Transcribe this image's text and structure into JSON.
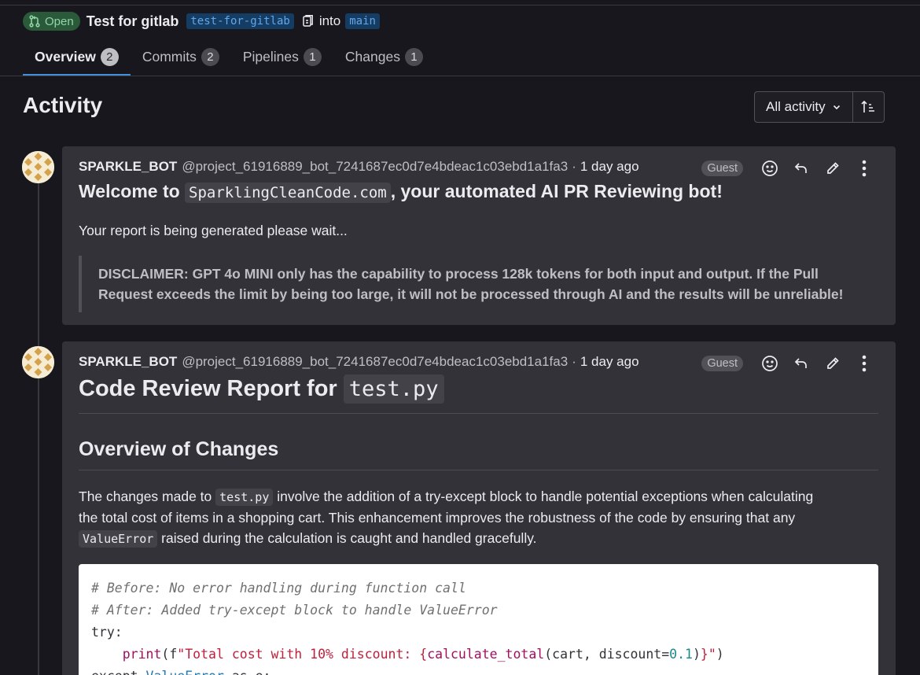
{
  "header": {
    "status_label": "Open",
    "title": "Test for gitlab",
    "source_branch": "test-for-gitlab",
    "into_label": "into",
    "target_branch": "main"
  },
  "tabs": [
    {
      "label": "Overview",
      "count": "2",
      "active": true
    },
    {
      "label": "Commits",
      "count": "2"
    },
    {
      "label": "Pipelines",
      "count": "1"
    },
    {
      "label": "Changes",
      "count": "1"
    }
  ],
  "activity": {
    "title": "Activity",
    "filter_label": "All activity"
  },
  "notes": [
    {
      "author": "SPARKLE_BOT",
      "username": "@project_61916889_bot_7241687ec0d7e4bdeac1c03ebd1a1fa3",
      "time": "1 day ago",
      "role": "Guest",
      "heading_pre": "Welcome to ",
      "heading_code": "SparklingCleanCode.com",
      "heading_post": ", your automated AI PR Reviewing bot!",
      "body": "Your report is being generated please wait...",
      "quote_line1": "DISCLAIMER: GPT 4o MINI only has the capability to process 128k tokens for both input and output. If the Pull",
      "quote_line2": "Request exceeds the limit by being too large, it will not be processed through AI and the results will be unreliable!"
    },
    {
      "author": "SPARKLE_BOT",
      "username": "@project_61916889_bot_7241687ec0d7e4bdeac1c03ebd1a1fa3",
      "time": "1 day ago",
      "role": "Guest",
      "h1_pre": "Code Review Report for ",
      "h1_code": "test.py",
      "h2": "Overview of Changes",
      "para_1": "The changes made to ",
      "para_code_1": "test.py",
      "para_2": " involve the addition of a try-except block to handle potential exceptions when calculating",
      "para_3": "the total cost of items in a shopping cart. This enhancement improves the robustness of the code by ensuring that any",
      "para_code_2": "ValueError",
      "para_4": " raised during the calculation is caught and handled gracefully.",
      "code": {
        "line1": "# Before: No error handling during function call",
        "line2": "# After: Added try-except block to handle ValueError",
        "line3": "try:",
        "line4_indent": "    ",
        "line4_fn": "print",
        "line4_a": "(f",
        "line4_str": "\"Total cost with 10% discount: {",
        "line4_call": "calculate_total",
        "line4_b": "(cart, discount=",
        "line4_num": "0.1",
        "line4_c": ")",
        "line4_str2": "}\"",
        "line4_d": ")",
        "line5_kw": "except ",
        "line5_cls": "ValueError",
        "line5_rest": " as e:"
      }
    }
  ],
  "colors": {
    "background": "#18171d",
    "card": "#333238",
    "accent": "#428fdc",
    "open_badge": "#2b5a3a"
  },
  "icons": {
    "status": "merge-request-icon",
    "copy": "copy-icon",
    "sort": "sort-icon",
    "emoji": "smiley-icon",
    "reply": "reply-icon",
    "edit": "pencil-icon",
    "more": "kebab-icon"
  }
}
